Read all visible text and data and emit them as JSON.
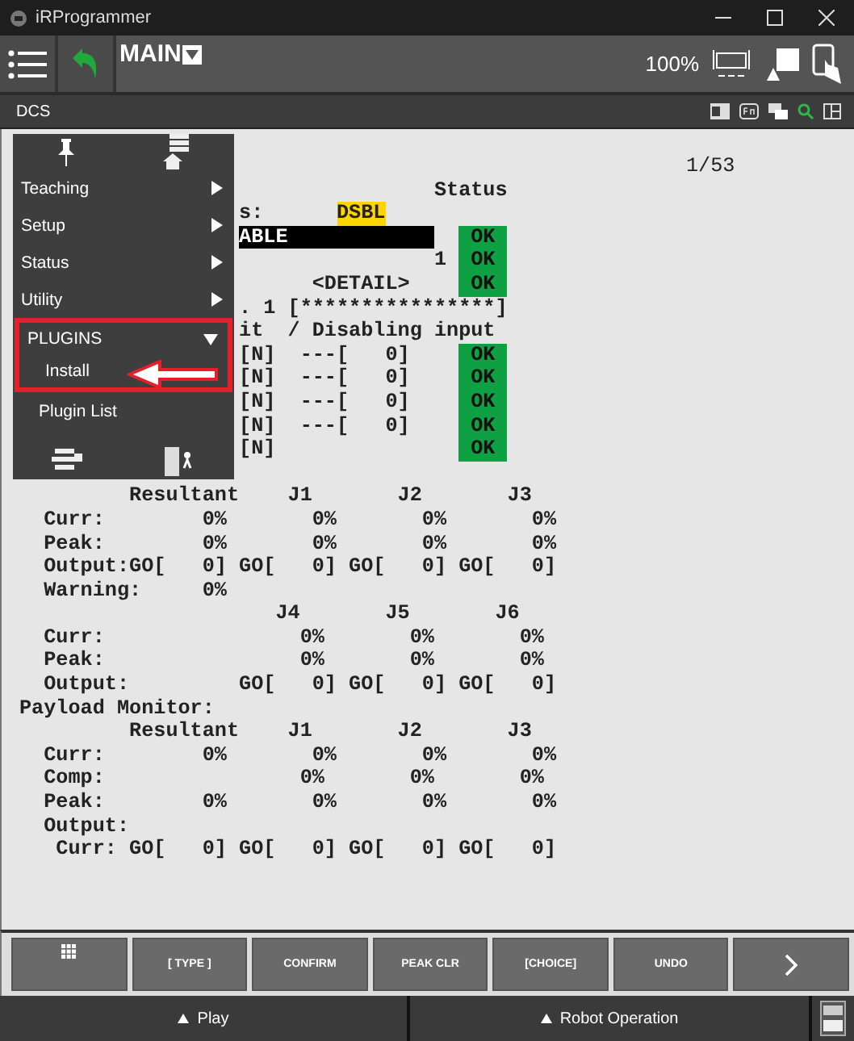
{
  "window": {
    "title": "iRProgrammer"
  },
  "toolbar": {
    "program": "MAIN",
    "override": "100%"
  },
  "subbar": {
    "title": "DCS"
  },
  "screen": {
    "page": "1/53",
    "lines": [
      {
        "text": "                                  Status"
      },
      {
        "text": "                  s:      ",
        "value": "DSBL",
        "kind": "warning"
      },
      {
        "value": "ABLE",
        "kind": "field",
        "status": "OK"
      },
      {
        "text": "                                  1",
        "status": "OK"
      },
      {
        "text": "                        <DETAIL>",
        "status": "OK"
      },
      {
        "text": "                  . 1 [****************]"
      },
      {
        "text": "                  it  / Disabling input"
      },
      {
        "text": "                  [N]  ---[   0]",
        "status": "OK"
      },
      {
        "text": "                  [N]  ---[   0]",
        "status": "OK"
      },
      {
        "text": "                  [N]  ---[   0]",
        "status": "OK"
      },
      {
        "text": "                  [N]  ---[   0]",
        "status": "OK"
      },
      {
        "text": "                  [N]",
        "status": "OK"
      },
      {
        "text": "         Resultant    J1       J2       J3",
        "gap_before": true
      },
      {
        "text": "  Curr:        0%       0%       0%       0%"
      },
      {
        "text": "  Peak:        0%       0%       0%       0%"
      },
      {
        "text": "  Output:GO[   0] GO[   0] GO[   0] GO[   0]"
      },
      {
        "text": "  Warning:     0%"
      },
      {
        "text": "                     J4       J5       J6"
      },
      {
        "text": "  Curr:                0%       0%       0%"
      },
      {
        "text": "  Peak:                0%       0%       0%"
      },
      {
        "text": "  Output:         GO[   0] GO[   0] GO[   0]"
      },
      {
        "text": "Payload Monitor:"
      },
      {
        "text": "         Resultant    J1       J2       J3"
      },
      {
        "text": "  Curr:        0%       0%       0%       0%"
      },
      {
        "text": "  Comp:                0%       0%       0%"
      },
      {
        "text": "  Peak:        0%       0%       0%       0%"
      },
      {
        "text": "  Output:"
      },
      {
        "text": "   Curr: GO[   0] GO[   0] GO[   0] GO[   0]"
      }
    ]
  },
  "menu": {
    "items": [
      {
        "label": "Teaching",
        "expanded": false
      },
      {
        "label": "Setup",
        "expanded": false
      },
      {
        "label": "Status",
        "expanded": false
      },
      {
        "label": "Utility",
        "expanded": false
      },
      {
        "label": "PLUGINS",
        "expanded": true,
        "children": [
          {
            "label": "Install"
          },
          {
            "label": "Plugin List"
          }
        ]
      }
    ]
  },
  "function_keys": [
    "[ TYPE ]",
    "CONFIRM",
    "PEAK CLR",
    "[CHOICE]",
    "UNDO"
  ],
  "bottom_bar": [
    "Play",
    "Robot Operation"
  ]
}
